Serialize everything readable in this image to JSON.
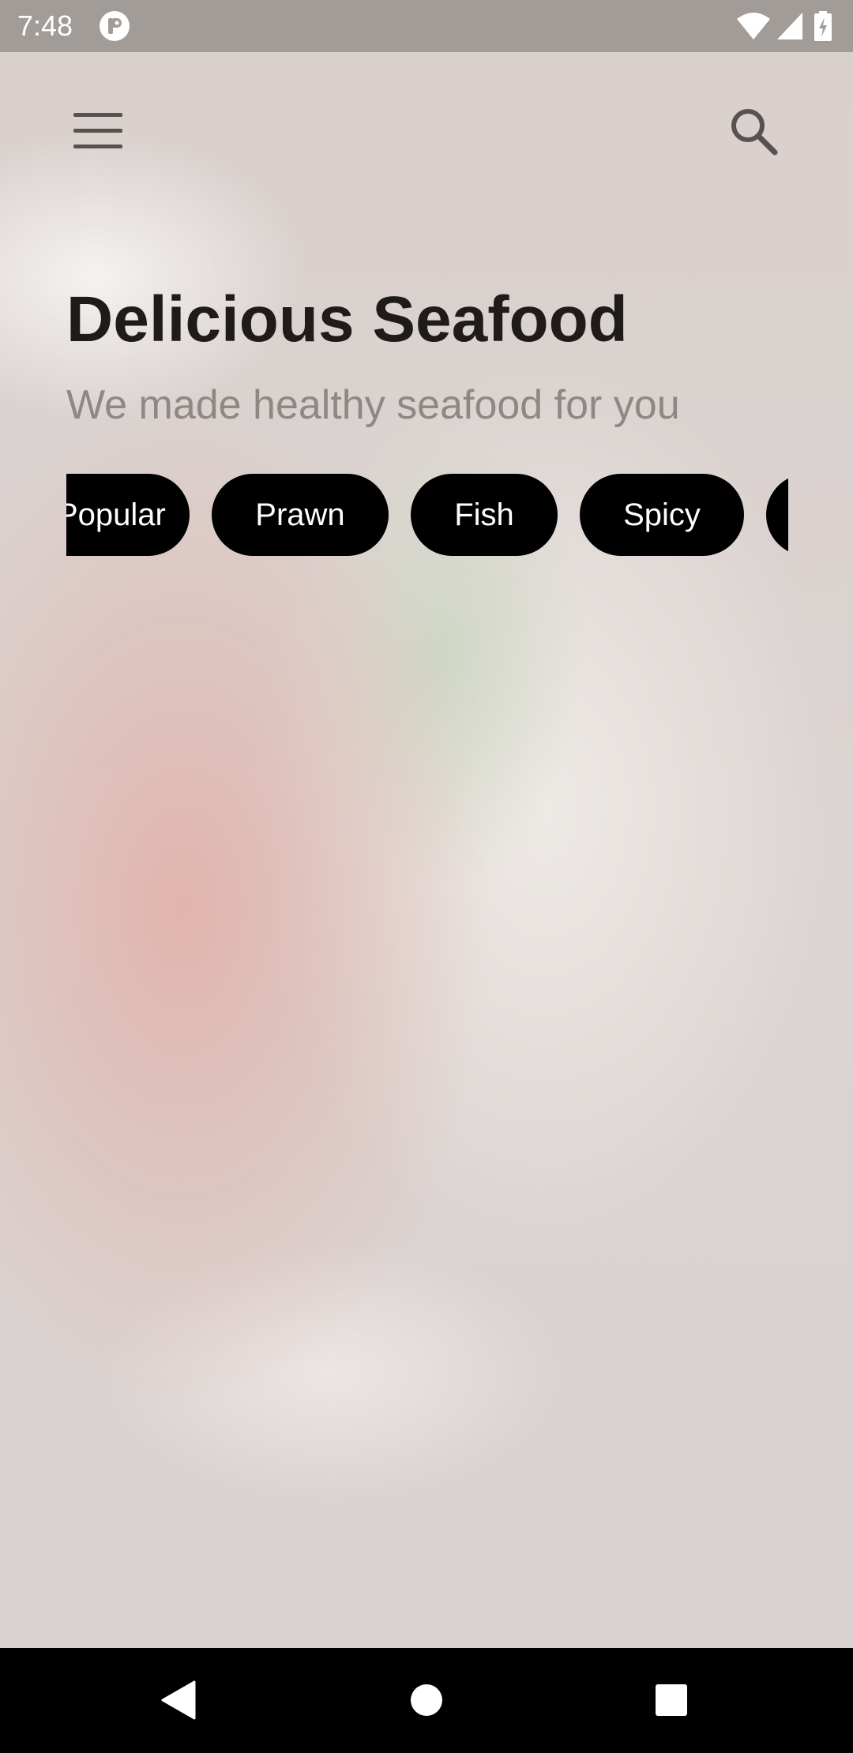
{
  "status_bar": {
    "time": "7:48",
    "icons": [
      "app-notification-icon",
      "wifi-icon",
      "cell-signal-icon",
      "battery-charging-icon"
    ]
  },
  "toolbar": {
    "menu_icon": "hamburger-menu-icon",
    "search_icon": "search-icon"
  },
  "header": {
    "title": "Delicious Seafood",
    "subtitle": "We made healthy seafood for you"
  },
  "categories": [
    {
      "label": "Popular"
    },
    {
      "label": "Prawn"
    },
    {
      "label": "Fish"
    },
    {
      "label": "Spicy"
    },
    {
      "label": ""
    }
  ],
  "nav_bar": {
    "icons": [
      "back-icon",
      "home-icon",
      "recents-icon"
    ]
  },
  "colors": {
    "chip_background": "#000000",
    "chip_text": "#ffffff",
    "title": "#1e1b1a",
    "subtitle": "#8f8784"
  }
}
